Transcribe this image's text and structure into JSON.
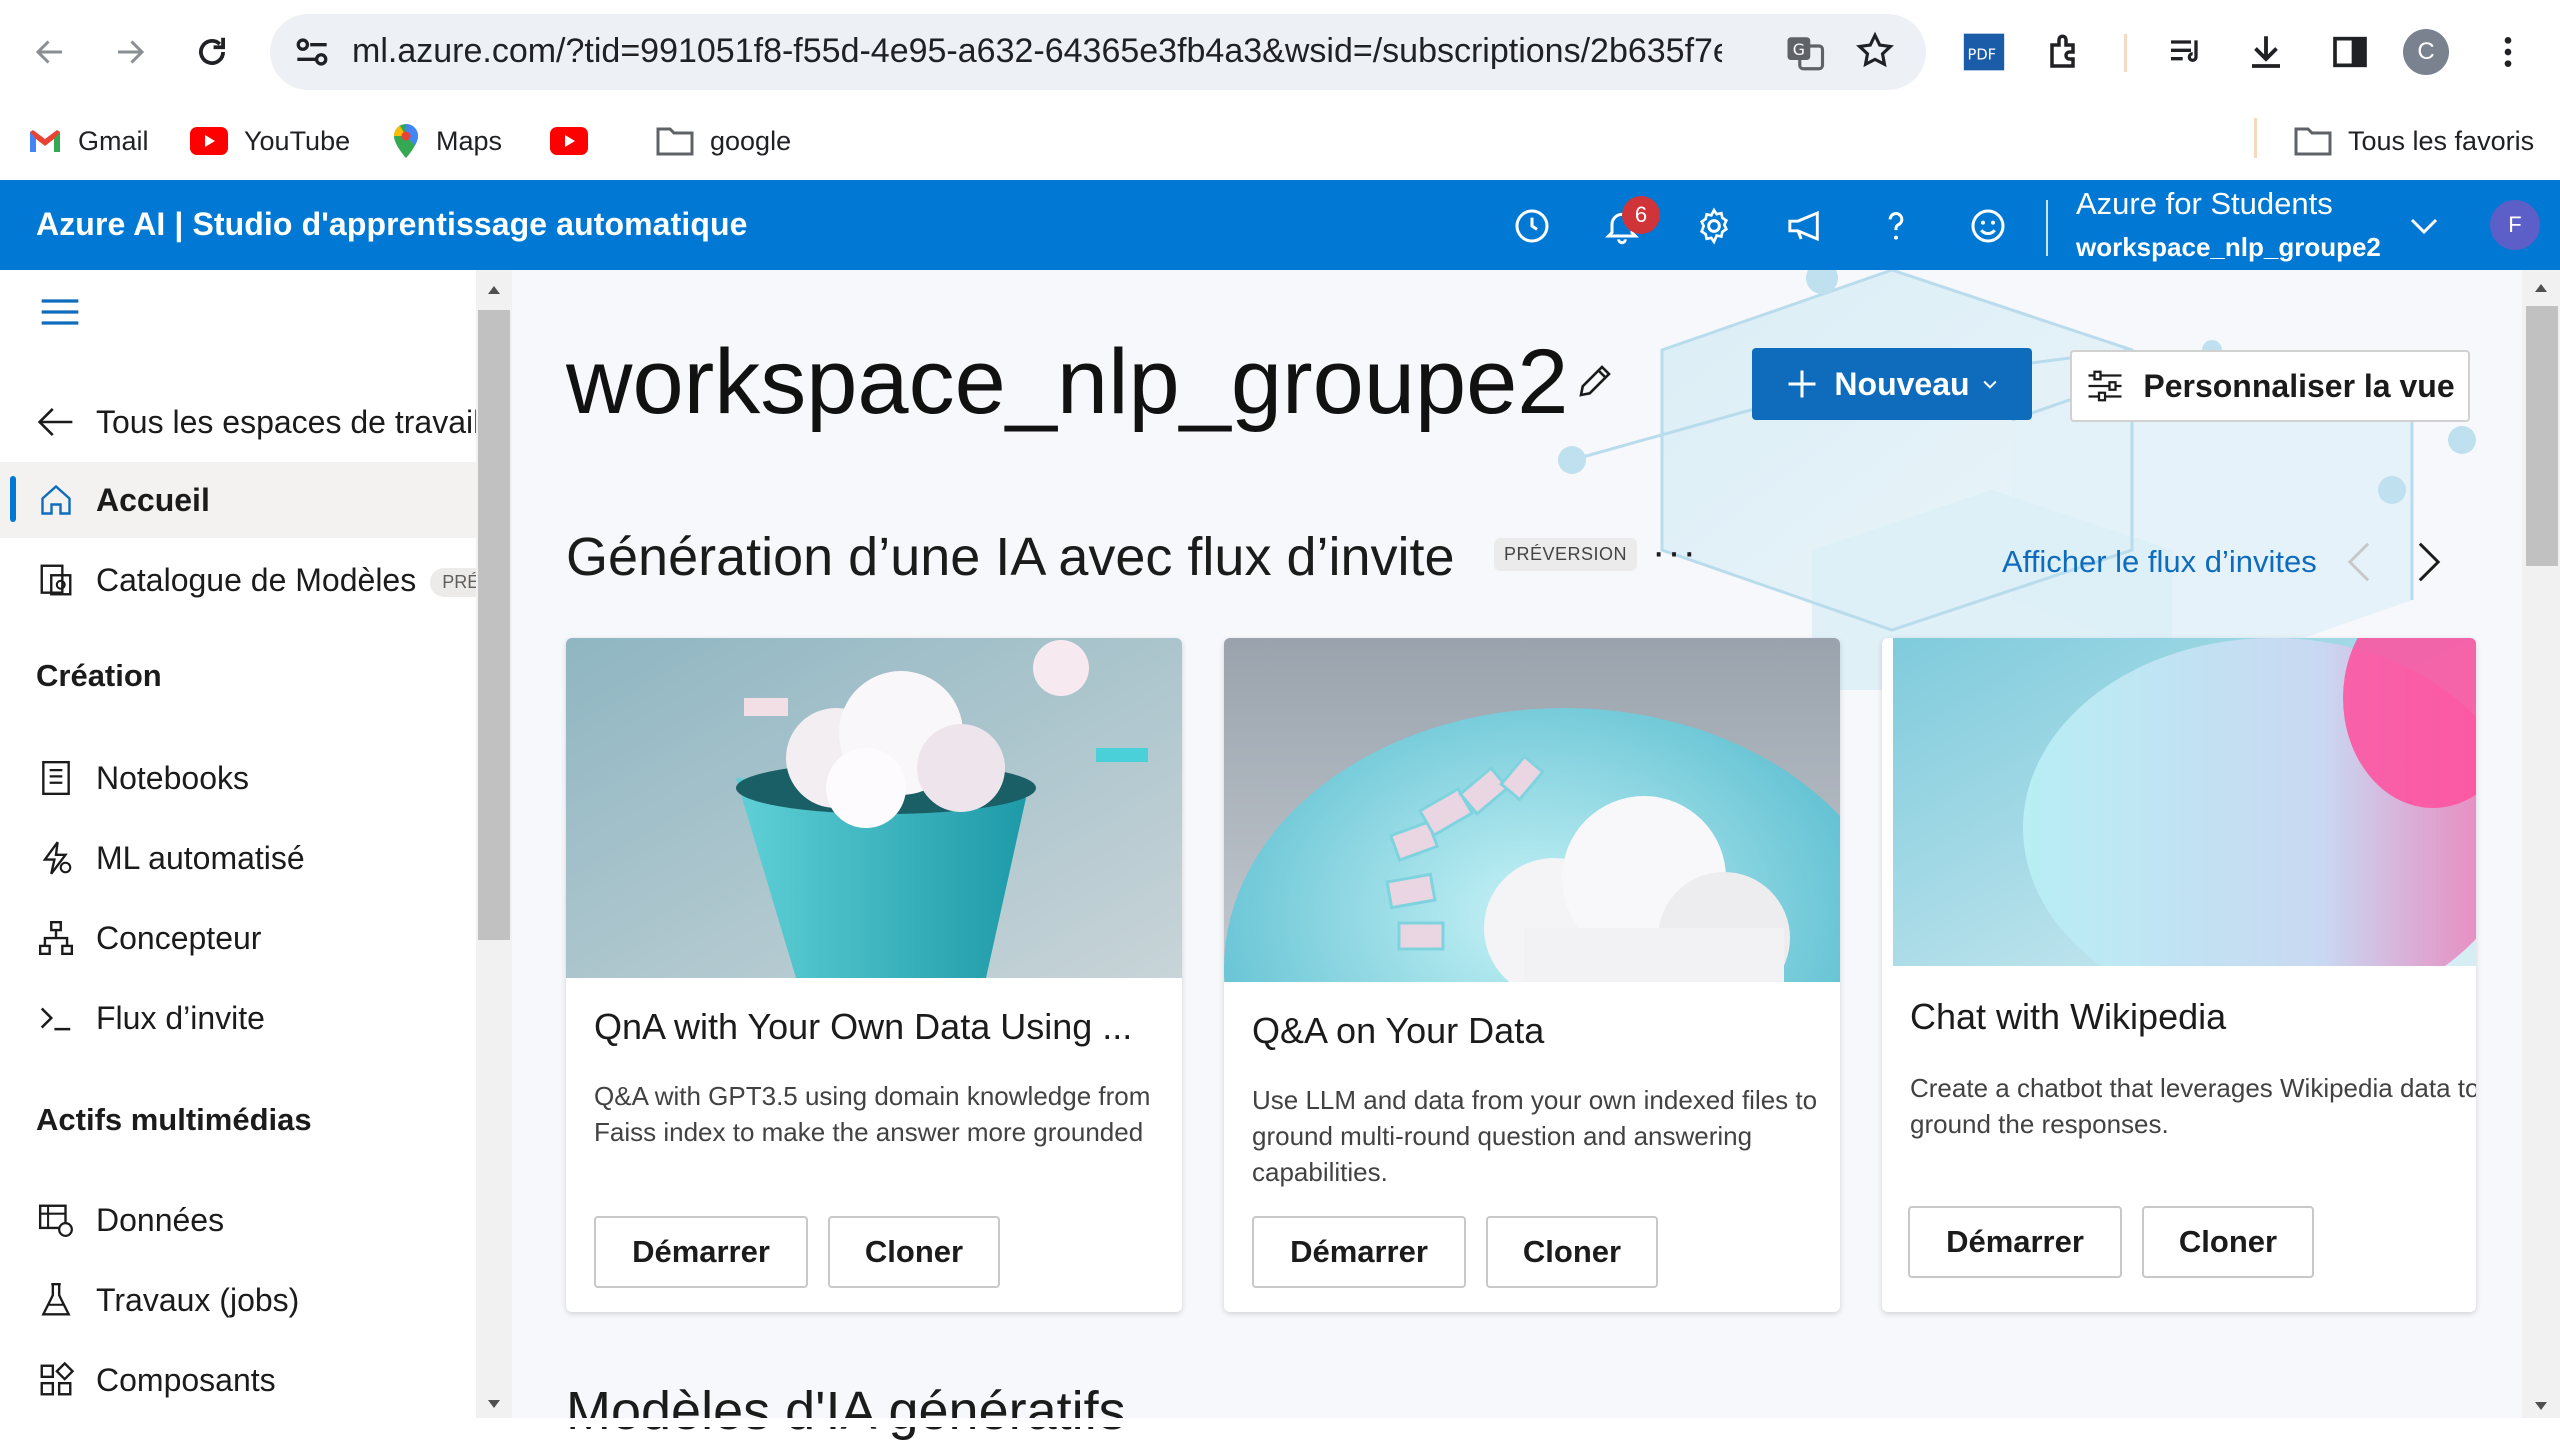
{
  "browser": {
    "url": "ml.azure.com/?tid=991051f8-f55d-4e95-a632-64365e3fb4a3&wsid=/subscriptions/2b635f7e-bdd3-...",
    "profile_initial": "C",
    "bookmarks": [
      {
        "label": "Gmail",
        "icon": "gmail-icon"
      },
      {
        "label": "YouTube",
        "icon": "youtube-icon"
      },
      {
        "label": "Maps",
        "icon": "maps-icon"
      },
      {
        "label": "",
        "icon": "youtube-icon"
      },
      {
        "label": "google",
        "icon": "folder-icon"
      }
    ],
    "all_bookmarks": "Tous les favoris",
    "extension_pdf": "PDF"
  },
  "header": {
    "title": "Azure AI | Studio d'apprentissage automatique",
    "notification_count": "6",
    "account_name": "Azure for Students",
    "workspace": "workspace_nlp_groupe2",
    "avatar_initial": "F",
    "accent": "#0078d4"
  },
  "sidebar": {
    "back": "Tous les espaces de travail",
    "home": "Accueil",
    "catalog": "Catalogue de Modèles",
    "catalog_tag": "PRÉVI",
    "section_creation": "Création",
    "creation_items": [
      "Notebooks",
      "ML automatisé",
      "Concepteur",
      "Flux d’invite"
    ],
    "section_assets": "Actifs multimédias",
    "asset_items": [
      "Données",
      "Travaux (jobs)",
      "Composants"
    ]
  },
  "main": {
    "workspace_title": "workspace_nlp_groupe2",
    "new_button": "Nouveau",
    "customize_button": "Personnaliser la vue",
    "section_title": "Génération d’une IA avec flux d’invite",
    "section_tag": "PRÉVERSION",
    "section_link": "Afficher le flux d’invites",
    "cards": [
      {
        "title": "QnA with Your Own Data Using ...",
        "desc": "Q&A with GPT3.5 using domain knowledge from Faiss index to make the answer more grounded",
        "start": "Démarrer",
        "clone": "Cloner"
      },
      {
        "title": "Q&A on Your Data",
        "desc": "Use LLM and data from your own indexed files to ground multi-round question and answering capabilities.",
        "start": "Démarrer",
        "clone": "Cloner"
      },
      {
        "title": "Chat with Wikipedia",
        "desc": "Create a chatbot that leverages Wikipedia data to ground the responses.",
        "start": "Démarrer",
        "clone": "Cloner"
      }
    ],
    "next_section": "Modèles d'IA génératifs"
  }
}
